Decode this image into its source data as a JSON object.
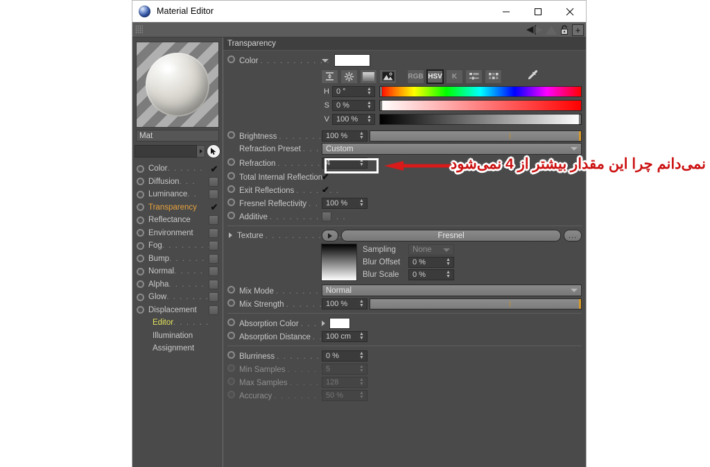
{
  "window": {
    "title": "Material Editor",
    "app_icon": "material-sphere-icon",
    "minimize": "—",
    "maximize": "□",
    "close": "✕"
  },
  "toolbar": {
    "grip": "drag-grip",
    "icons": [
      "triangle-left-icon",
      "triangle-right-outline-icon",
      "triangle-up-outline-icon",
      "lock-open-icon",
      "plus-box-icon"
    ]
  },
  "sidebar": {
    "material_name": "Mat",
    "search_value": "",
    "cursor_icon": "mouse-pointer-icon",
    "channels": [
      {
        "label": "Color",
        "dots": ". . . . . .",
        "checked": true,
        "enabled": true,
        "accent": false
      },
      {
        "label": "Diffusion",
        "dots": ". . .",
        "checked": false,
        "enabled": true,
        "accent": false
      },
      {
        "label": "Luminance",
        "dots": ". .",
        "checked": false,
        "enabled": true,
        "accent": false
      },
      {
        "label": "Transparency",
        "dots": "",
        "checked": true,
        "enabled": true,
        "accent": true
      },
      {
        "label": "Reflectance",
        "dots": "",
        "checked": false,
        "enabled": true,
        "accent": false
      },
      {
        "label": "Environment",
        "dots": "",
        "checked": false,
        "enabled": true,
        "accent": false
      },
      {
        "label": "Fog",
        "dots": ". . . . . . . .",
        "checked": false,
        "enabled": true,
        "accent": false
      },
      {
        "label": "Bump",
        "dots": ". . . . . .",
        "checked": false,
        "enabled": true,
        "accent": false
      },
      {
        "label": "Normal",
        "dots": ". . . . .",
        "checked": false,
        "enabled": true,
        "accent": false
      },
      {
        "label": "Alpha",
        "dots": ". . . . . .",
        "checked": false,
        "enabled": true,
        "accent": false
      },
      {
        "label": "Glow",
        "dots": ". . . . . . .",
        "checked": false,
        "enabled": true,
        "accent": false
      },
      {
        "label": "Displacement",
        "dots": "",
        "checked": false,
        "enabled": true,
        "accent": false
      }
    ],
    "plain_items": [
      {
        "label": "Editor",
        "dots": ". . . . . .",
        "yellow": true
      },
      {
        "label": "Illumination",
        "dots": "",
        "yellow": false
      },
      {
        "label": "Assignment",
        "dots": "",
        "yellow": false
      }
    ]
  },
  "main": {
    "section_title": "Transparency",
    "color": {
      "label": "Color",
      "dots": ". . . . . . . . . . . .",
      "swatch_hex": "#ffffff",
      "mode_buttons": [
        {
          "name": "range-icon",
          "label": "",
          "selected": false
        },
        {
          "name": "color-wheel-icon",
          "label": "",
          "selected": false
        },
        {
          "name": "gradient-icon",
          "label": "",
          "selected": false
        },
        {
          "name": "image-picker-icon",
          "label": "",
          "selected": false
        },
        {
          "name": "rgb-mode-button",
          "label": "RGB",
          "selected": false
        },
        {
          "name": "hsv-mode-button",
          "label": "HSV",
          "selected": true
        },
        {
          "name": "kelvin-mode-button",
          "label": "K",
          "selected": false
        },
        {
          "name": "sliders-icon",
          "label": "",
          "selected": false
        },
        {
          "name": "swatches-icon",
          "label": "",
          "selected": false
        },
        {
          "name": "eyedropper-icon",
          "label": "",
          "selected": false
        }
      ],
      "hsv": [
        {
          "channel": "H",
          "value": "0 °",
          "marker_pct": 0
        },
        {
          "channel": "S",
          "value": "0 %",
          "marker_pct": 0
        },
        {
          "channel": "V",
          "value": "100 %",
          "marker_pct": 100
        }
      ]
    },
    "brightness": {
      "label": "Brightness",
      "dots": ". . . . . . . . . . .",
      "value": "100 %",
      "slider_pct": 100
    },
    "refraction_preset": {
      "label": "Refraction Preset",
      "dots": ". . . . . .",
      "value": "Custom"
    },
    "refraction": {
      "label": "Refraction",
      "dots": ". . . . . . . . . . .",
      "value": "4"
    },
    "total_internal_reflection": {
      "label": "Total Internal Reflection",
      "dots": "",
      "checked": true
    },
    "exit_reflections": {
      "label": "Exit Reflections",
      "dots": ". . . . . . .",
      "checked": true
    },
    "fresnel_reflectivity": {
      "label": "Fresnel Reflectivity",
      "dots": ". . . .",
      "value": "100 %"
    },
    "additive": {
      "label": "Additive",
      "dots": ". . . . . . . . . . . .",
      "checked": false
    },
    "texture": {
      "label": "Texture",
      "dots": ". . . . . . . . . . . .",
      "value": "Fresnel",
      "more_label": "...",
      "play_icon": "play-triangle-icon"
    },
    "sampling": {
      "label": "Sampling",
      "value": "None"
    },
    "blur_offset": {
      "label": "Blur Offset",
      "value": "0 %"
    },
    "blur_scale": {
      "label": "Blur Scale",
      "value": "0 %"
    },
    "mix_mode": {
      "label": "Mix Mode",
      "dots": ". . . . . . . . . . .",
      "value": "Normal"
    },
    "mix_strength": {
      "label": "Mix Strength",
      "dots": ". . . . . . . . .",
      "value": "100 %",
      "slider_pct": 100
    },
    "absorption_color": {
      "label": "Absorption Color",
      "dots": ". . .",
      "swatch_hex": "#ffffff"
    },
    "absorption_distance": {
      "label": "Absorption Distance",
      "dots": ". . .",
      "value": "100 cm"
    },
    "blurriness": {
      "label": "Blurriness",
      "dots": ". . . . . . . . . . .",
      "value": "0 %"
    },
    "min_samples": {
      "label": "Min Samples",
      "dots": ". . . . . . . . .",
      "value": "5"
    },
    "max_samples": {
      "label": "Max Samples",
      "dots": ". . . . . . . . .",
      "value": "128"
    },
    "accuracy": {
      "label": "Accuracy",
      "dots": ". . . . . . . . . . . .",
      "value": "50 %"
    }
  },
  "annotation": {
    "text": "نمی‌دانم چرا این مقدار بیشتر از 4 نمی‌شود",
    "color": "#cc1010",
    "outline_color": "#ffffff",
    "arrow": "left-arrow-annotation",
    "highlight_box": "refraction-field-highlight"
  }
}
